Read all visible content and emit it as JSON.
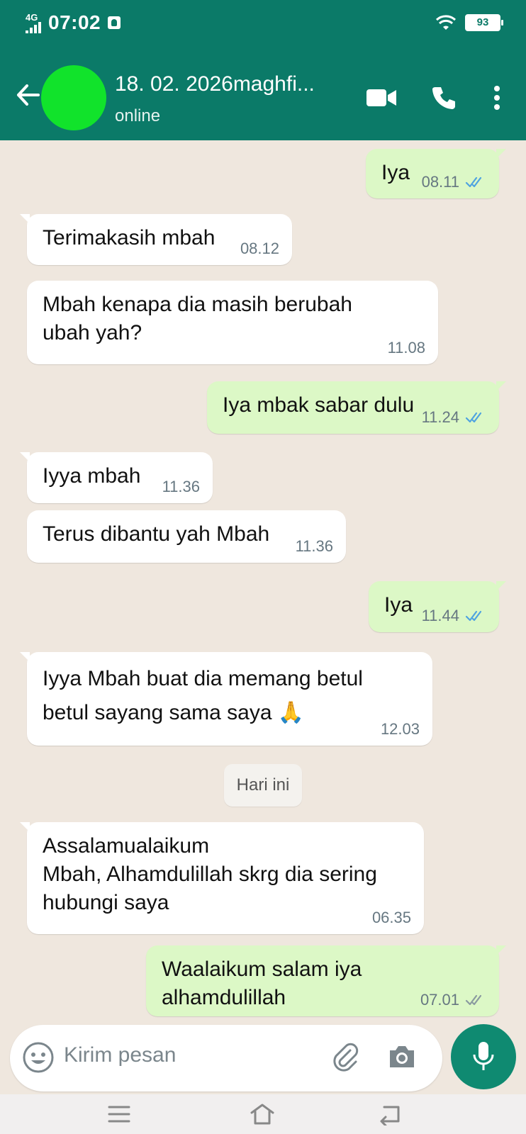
{
  "statusbar": {
    "network": "4G",
    "time": "07:02",
    "battery": "93"
  },
  "header": {
    "title": "18. 02. 2026maghfi...",
    "subtitle": "online",
    "icons": [
      "back-arrow-icon",
      "video-call-icon",
      "voice-call-icon",
      "more-options-icon"
    ]
  },
  "messages": [
    {
      "dir": "out",
      "text": "Iya",
      "time": "08.11",
      "status": "read"
    },
    {
      "dir": "in",
      "text": "Terimakasih mbah",
      "time": "08.12"
    },
    {
      "dir": "in",
      "text": "Mbah kenapa dia masih berubah\nubah yah?",
      "time": "11.08"
    },
    {
      "dir": "out",
      "text": "Iya mbak sabar dulu",
      "time": "11.24",
      "status": "read"
    },
    {
      "dir": "in",
      "text": "Iyya mbah",
      "time": "11.36"
    },
    {
      "dir": "in",
      "text": "Terus dibantu yah Mbah",
      "time": "11.36"
    },
    {
      "dir": "out",
      "text": "Iya",
      "time": "11.44",
      "status": "read"
    },
    {
      "dir": "in",
      "text": "Iyya Mbah buat dia memang betul\nbetul sayang sama saya 🙏",
      "time": "12.03"
    },
    {
      "dir": "in",
      "text": "Assalamualaikum\nMbah, Alhamdulillah skrg dia sering\nhubungi saya",
      "time": "06.35"
    },
    {
      "dir": "out",
      "text": "Waalaikum salam iya alhamdulillah",
      "time": "07.01",
      "status": "delivered"
    }
  ],
  "date_divider": "Hari ini",
  "composer": {
    "placeholder": "Kirim pesan"
  },
  "colors": {
    "header": "#0b7a68",
    "outgoing_bubble": "#dcf8c6",
    "incoming_bubble": "#ffffff",
    "read_tick": "#4fa3e0",
    "mic_button": "#0f8a71",
    "avatar": "#11e32b"
  }
}
